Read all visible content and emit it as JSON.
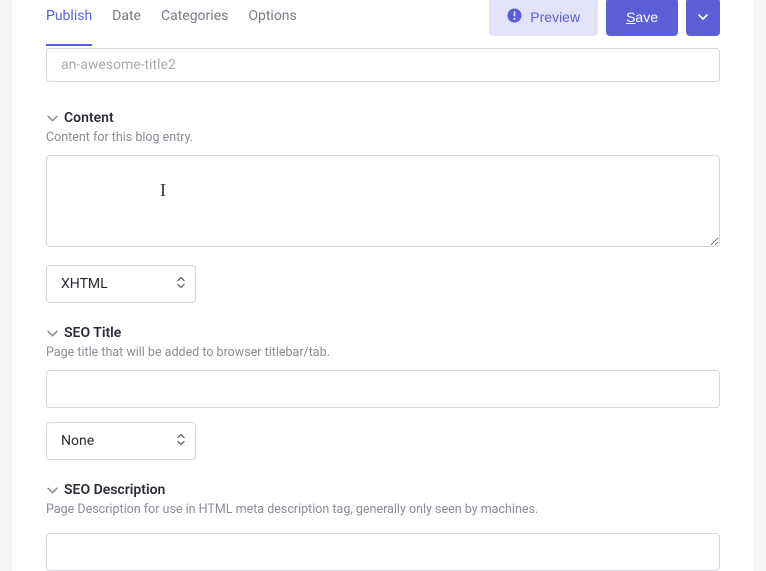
{
  "tabs": {
    "publish": "Publish",
    "date": "Date",
    "categories": "Categories",
    "options": "Options"
  },
  "actions": {
    "preview": "Preview",
    "save_prefix": "S",
    "save_rest": "ave"
  },
  "slug": {
    "value": "an-awesome-title2"
  },
  "content": {
    "title": "Content",
    "help": "Content for this blog entry.",
    "value": "",
    "format": "XHTML"
  },
  "seo_title": {
    "title": "SEO Title",
    "help": "Page title that will be added to browser titlebar/tab.",
    "value": "",
    "format": "None"
  },
  "seo_description": {
    "title": "SEO Description",
    "help": "Page Description for use in HTML meta description tag, generally only seen by machines.",
    "value": ""
  }
}
